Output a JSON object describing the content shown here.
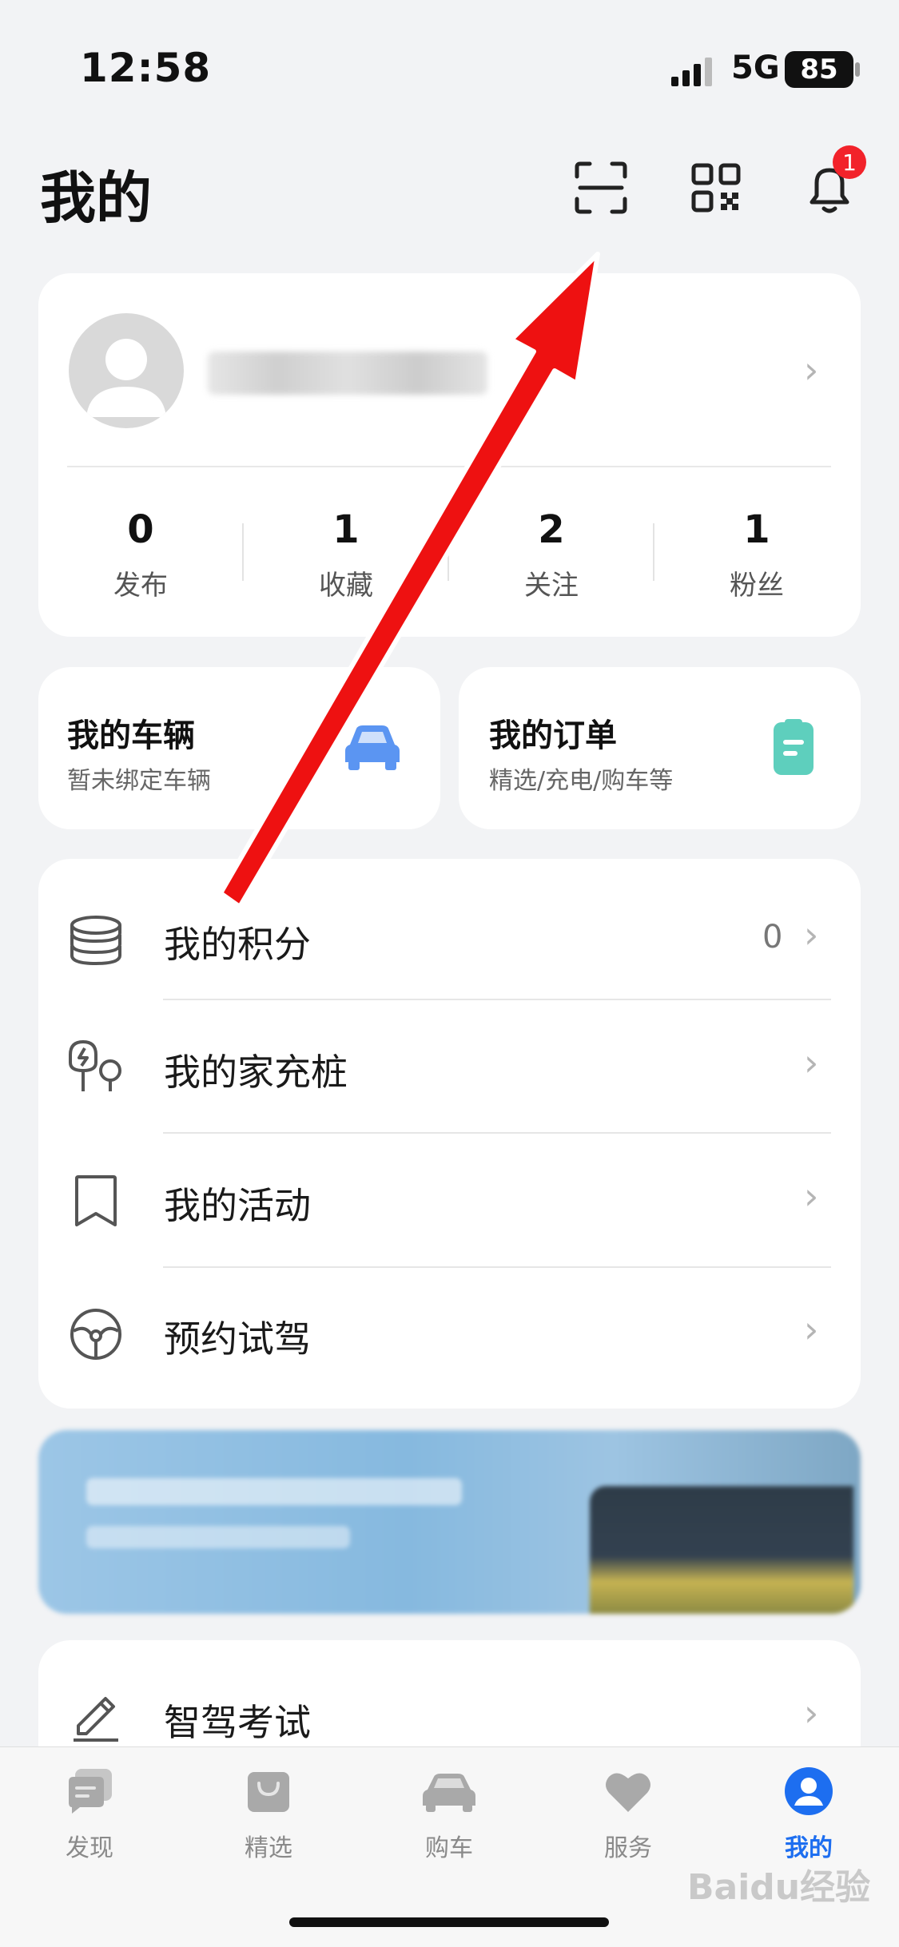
{
  "status_bar": {
    "time": "12:58",
    "network": "5G",
    "battery": "85"
  },
  "header": {
    "title": "我的",
    "notification_count": "1"
  },
  "profile": {
    "stats": [
      {
        "value": "0",
        "label": "发布"
      },
      {
        "value": "1",
        "label": "收藏"
      },
      {
        "value": "2",
        "label": "关注"
      },
      {
        "value": "1",
        "label": "粉丝"
      }
    ]
  },
  "cards": {
    "vehicle": {
      "title": "我的车辆",
      "subtitle": "暂未绑定车辆"
    },
    "orders": {
      "title": "我的订单",
      "subtitle": "精选/充电/购车等"
    }
  },
  "menu": [
    {
      "label": "我的积分",
      "value": "0",
      "icon": "coins-icon"
    },
    {
      "label": "我的家充桩",
      "icon": "charger-icon"
    },
    {
      "label": "我的活动",
      "icon": "bookmark-icon"
    },
    {
      "label": "预约试驾",
      "icon": "steering-wheel-icon"
    }
  ],
  "menu2": [
    {
      "label": "智驾考试",
      "icon": "pencil-icon"
    }
  ],
  "tabs": [
    {
      "label": "发现",
      "icon": "chat-icon"
    },
    {
      "label": "精选",
      "icon": "bag-icon"
    },
    {
      "label": "购车",
      "icon": "car-icon"
    },
    {
      "label": "服务",
      "icon": "heart-icon"
    },
    {
      "label": "我的",
      "icon": "user-icon",
      "active": true
    }
  ],
  "watermark": "Baidu经验",
  "colors": {
    "accent": "#1d6ef0",
    "arrow": "#ee1111",
    "badge": "#f2222a"
  }
}
